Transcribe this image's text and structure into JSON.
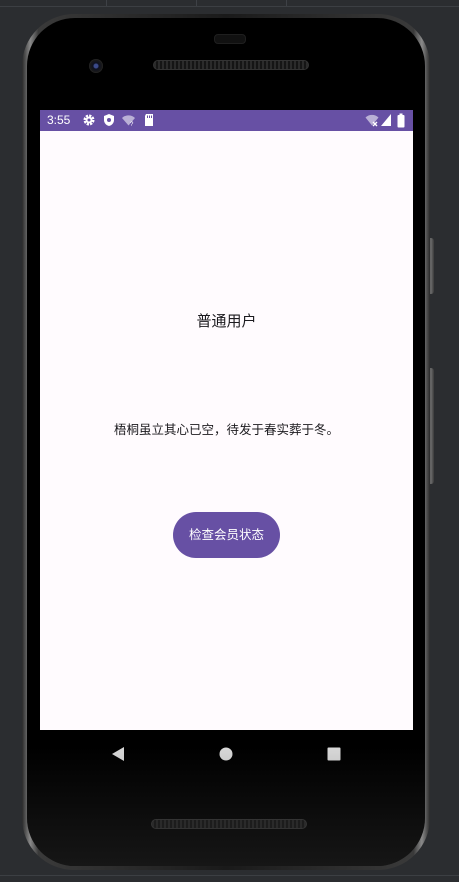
{
  "statusbar": {
    "time": "3:55",
    "left_icons": [
      "settings-icon",
      "shield-icon",
      "wifi-question-icon",
      "sd-card-icon"
    ],
    "right_icons": [
      "wifi-icon",
      "signal-icon",
      "battery-icon"
    ],
    "color": "#6750a4"
  },
  "main": {
    "title": "普通用户",
    "quote": "梧桐虽立其心已空，待发于春实葬于冬。",
    "button_label": "检查会员状态"
  },
  "navbar": {
    "buttons": [
      "back-icon",
      "home-icon",
      "recents-icon"
    ]
  },
  "colors": {
    "primary": "#6750a4",
    "surface": "#fffbfe",
    "on_surface": "#1c1b1f"
  }
}
